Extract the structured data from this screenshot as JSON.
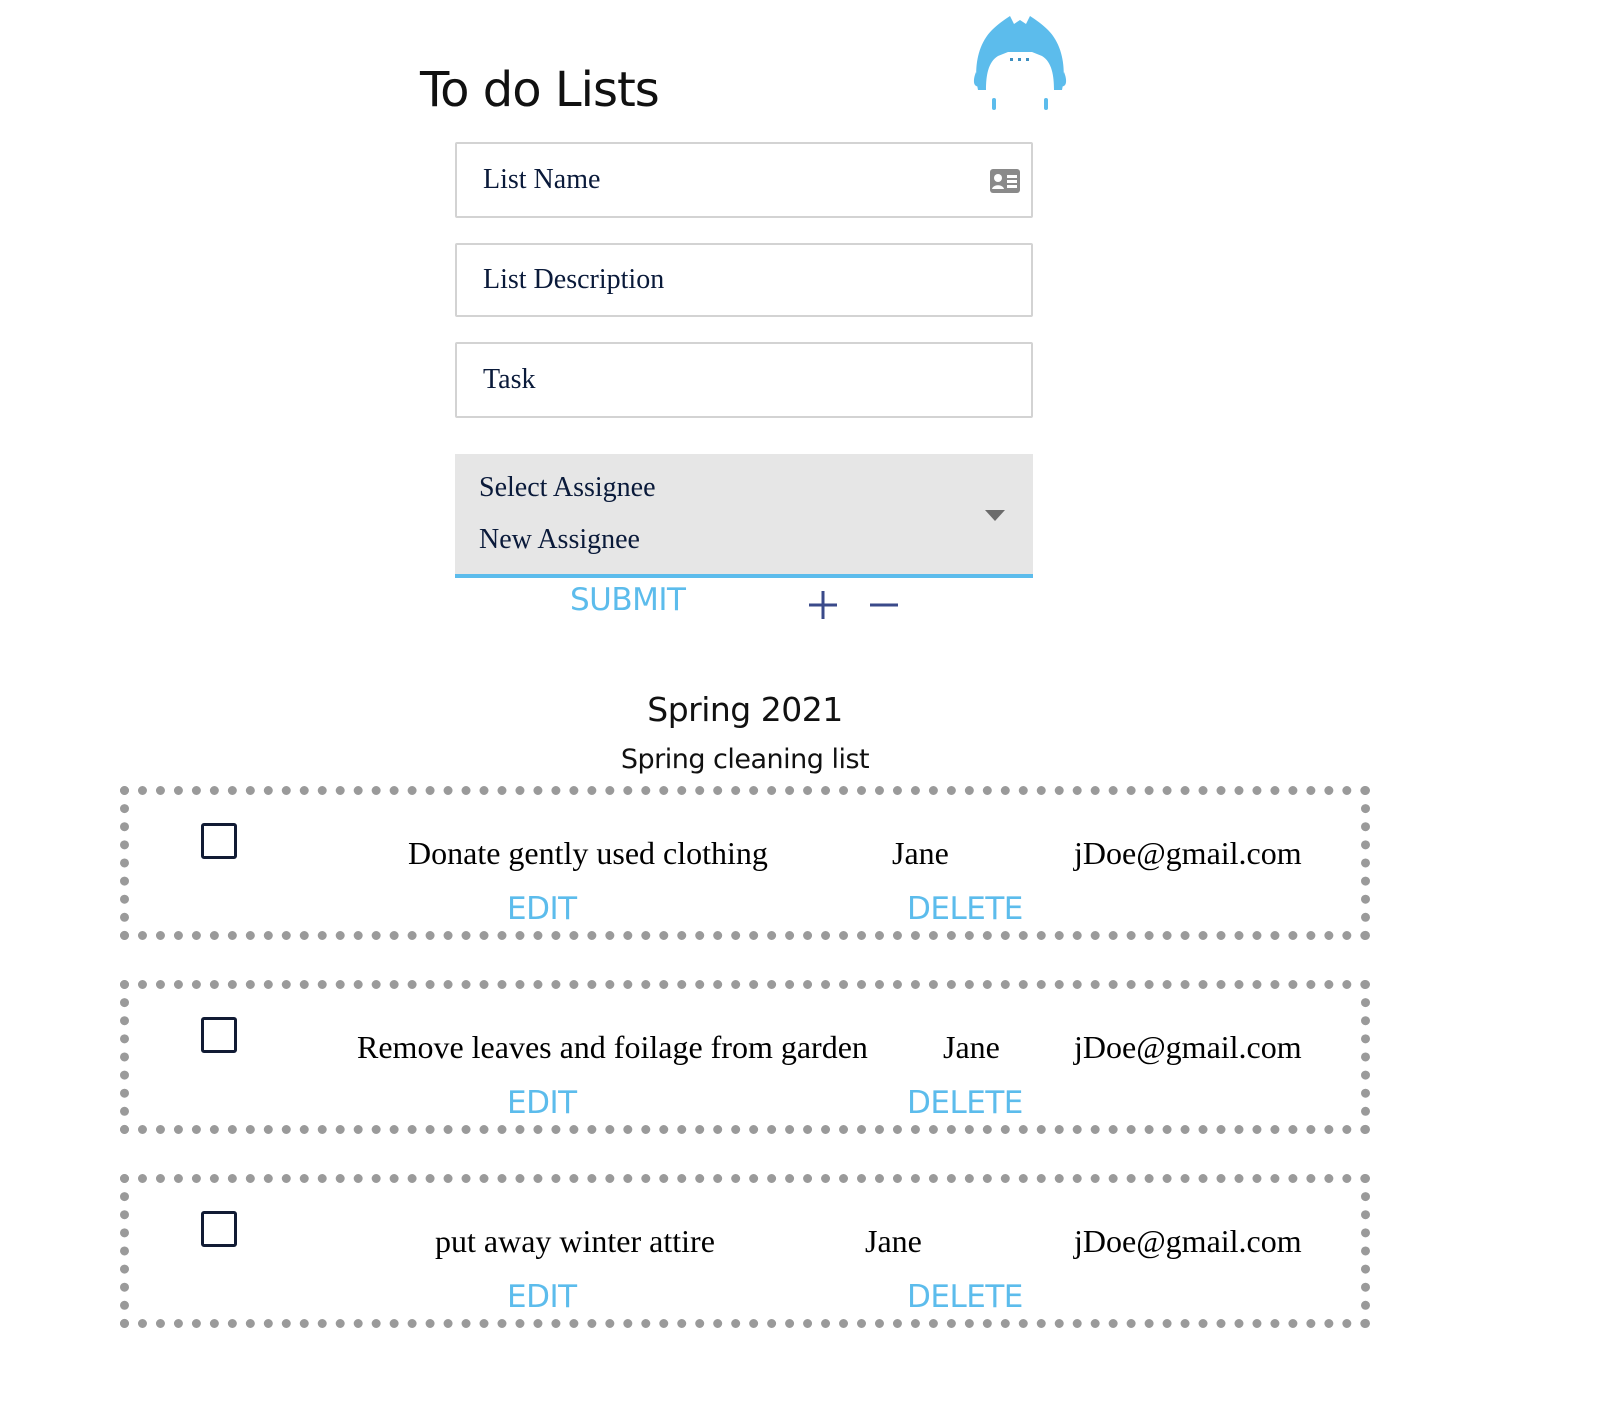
{
  "app": {
    "title": "To do Lists"
  },
  "form": {
    "list_name_placeholder": "List Name",
    "list_description_placeholder": "List Description",
    "task_placeholder": "Task",
    "assignee_options": [
      "Select Assignee",
      "New Assignee"
    ],
    "submit_label": "SUBMIT",
    "add_icon": "plus-icon",
    "remove_icon": "minus-icon",
    "field_icon": "contact-card-icon"
  },
  "list": {
    "title": "Spring 2021",
    "description": "Spring cleaning list",
    "tasks": [
      {
        "name": "Donate gently used clothing",
        "assignee": "Jane",
        "email": "jDoe@gmail.com",
        "done": false,
        "edit_label": "EDIT",
        "delete_label": "DELETE"
      },
      {
        "name": "Remove leaves and foilage from garden",
        "assignee": "Jane",
        "email": "jDoe@gmail.com",
        "done": false,
        "edit_label": "EDIT",
        "delete_label": "DELETE"
      },
      {
        "name": "put away winter attire",
        "assignee": "Jane",
        "email": "jDoe@gmail.com",
        "done": false,
        "edit_label": "EDIT",
        "delete_label": "DELETE"
      }
    ]
  },
  "colors": {
    "accent": "#5cbcec",
    "icon_dark": "#3a4a8a",
    "dotted_border": "#9a9a9a",
    "select_bg": "#e6e6e6",
    "mascot": "#5cbcec"
  }
}
